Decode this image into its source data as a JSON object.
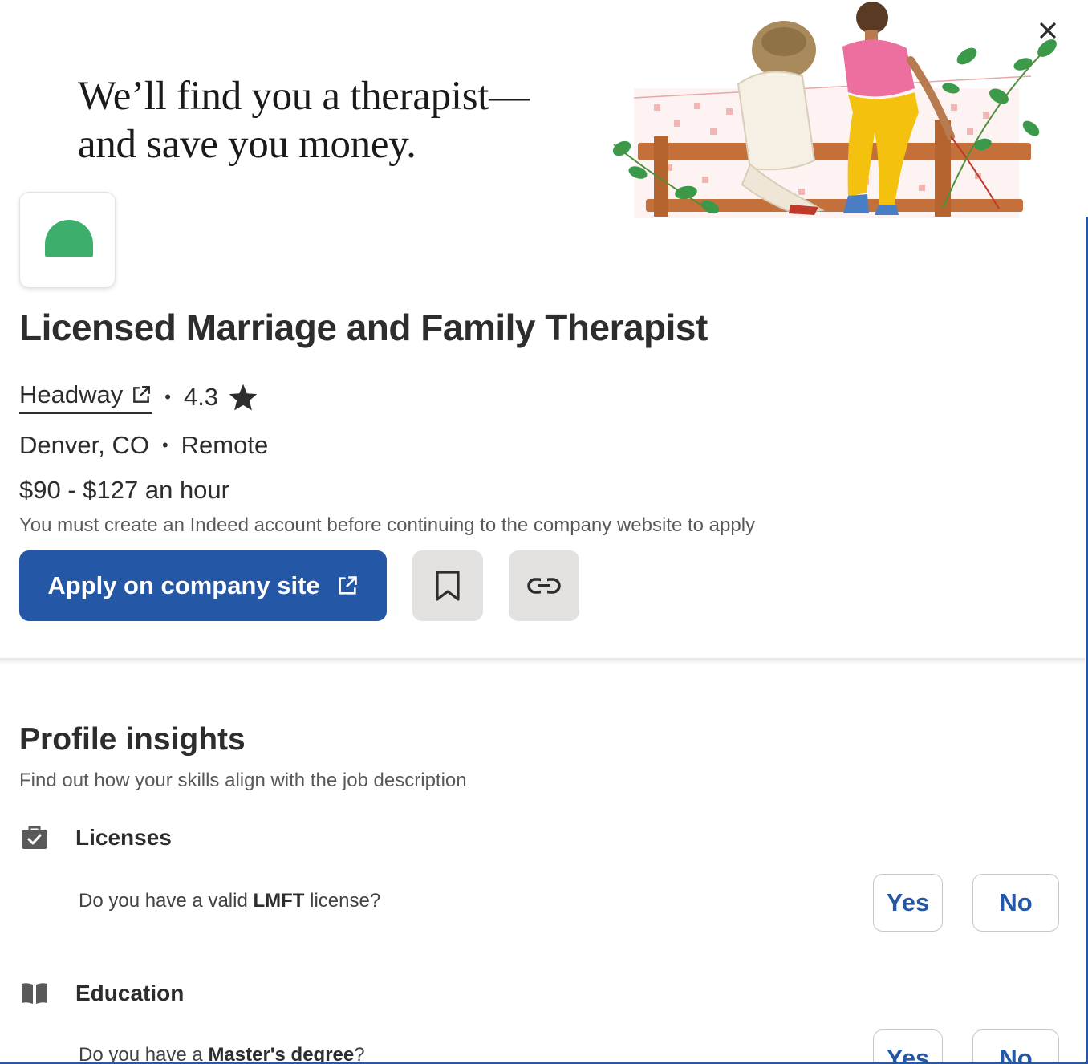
{
  "banner": {
    "headline_line1": "We’ll find you a therapist—",
    "headline_line2": "and save you money."
  },
  "job": {
    "title": "Licensed Marriage and Family Therapist",
    "company": "Headway",
    "separator": "•",
    "rating": "4.3",
    "location": "Denver, CO",
    "work_mode": "Remote",
    "salary": "$90 - $127 an hour",
    "notice": "You must create an Indeed account before continuing to the company website to apply"
  },
  "actions": {
    "apply_label": "Apply on company site"
  },
  "insights": {
    "title": "Profile insights",
    "subtitle": "Find out how your skills align with the job description",
    "items": [
      {
        "category": "Licenses",
        "icon": "briefcase-check-icon",
        "question_prefix": "Do you have a valid ",
        "question_bold": "LMFT",
        "question_suffix": " license?",
        "yes_label": "Yes",
        "no_label": "No"
      },
      {
        "category": "Education",
        "icon": "book-icon",
        "question_prefix": "Do you have a ",
        "question_bold": "Master's degree",
        "question_suffix": "?",
        "yes_label": "Yes",
        "no_label": "No"
      }
    ]
  },
  "colors": {
    "accent": "#2557a7",
    "logo_green": "#3dae6b",
    "secondary_button": "#e4e2e0"
  }
}
